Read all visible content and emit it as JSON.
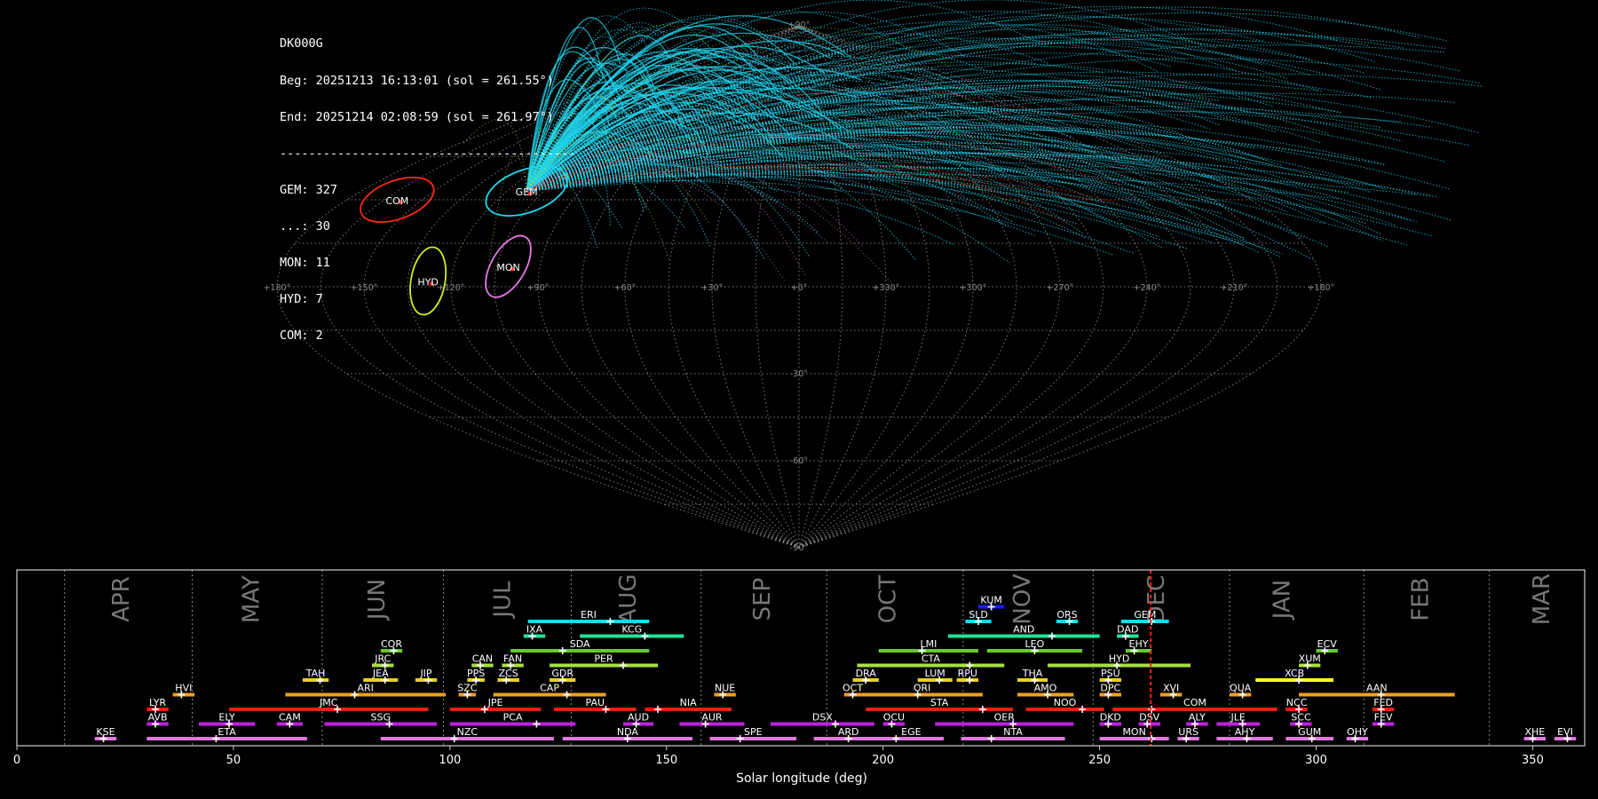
{
  "info": {
    "station": "DK000G",
    "begin": "Beg: 20251213 16:13:01 (sol = 261.55°)",
    "end": "End: 20251214 02:08:59 (sol = 261.97°)",
    "rule": "-----------------------------------------",
    "counts": [
      "GEM: 327",
      "...: 30",
      "MON: 11",
      "HYD: 7",
      "COM: 2"
    ]
  },
  "colors": {
    "background": "#000000",
    "grid": "#9a9a9a",
    "gem": "#1fd6f0",
    "sporadic": "#b8e020",
    "mon": "#e678e6",
    "hyd": "#c8f020",
    "com": "#ff2a10",
    "timeline_frame": "#cccccc",
    "solar_marker": "#ff2020"
  },
  "sky_map": {
    "projection": "sinusoidal",
    "center_ra": 0,
    "longitude_labels": [
      "+180°",
      "+150°",
      "+120°",
      "+90°",
      "+60°",
      "+30°",
      "+0°",
      "+330°",
      "+300°",
      "+270°",
      "+240°",
      "+210°",
      "+180°"
    ],
    "latitude_labels": [
      "+90°",
      "-30°",
      "-60°",
      "-90°"
    ],
    "radiants": [
      {
        "code": "GEM",
        "ra": 112,
        "dec": 33,
        "size": 10,
        "color": "#1fd6f0",
        "label": "GEM"
      },
      {
        "code": "COM",
        "ra": 160,
        "dec": 30,
        "size": 9,
        "color": "#ff2a10",
        "label": "COM"
      },
      {
        "code": "MON",
        "ra": 101,
        "dec": 7,
        "size": 8,
        "color": "#e678e6",
        "label": "MON"
      },
      {
        "code": "HYD",
        "ra": 128,
        "dec": 2,
        "size": 8,
        "color": "#c8f020",
        "label": "HYD"
      }
    ]
  },
  "chart_data": {
    "type": "timeline",
    "xlabel": "Solar longitude (deg)",
    "xlim": [
      0,
      362
    ],
    "xticks": [
      0,
      50,
      100,
      150,
      200,
      250,
      300,
      350
    ],
    "current_sol": 261.8,
    "months": [
      {
        "name": "APR",
        "pos": 24,
        "boundary": 11
      },
      {
        "name": "MAY",
        "pos": 54,
        "boundary": 40.5
      },
      {
        "name": "JUN",
        "pos": 83,
        "boundary": 70.5
      },
      {
        "name": "JUL",
        "pos": 112,
        "boundary": 98.5
      },
      {
        "name": "AUG",
        "pos": 141,
        "boundary": 128
      },
      {
        "name": "SEP",
        "pos": 172,
        "boundary": 158
      },
      {
        "name": "OCT",
        "pos": 201,
        "boundary": 187
      },
      {
        "name": "NOV",
        "pos": 232,
        "boundary": 218.5
      },
      {
        "name": "DEC",
        "pos": 263,
        "boundary": 248.5
      },
      {
        "name": "JAN",
        "pos": 292,
        "boundary": 280
      },
      {
        "name": "FEB",
        "pos": 324,
        "boundary": 311
      },
      {
        "name": "MAR",
        "pos": 352,
        "boundary": 340
      }
    ],
    "showers": [
      {
        "code": "KUM",
        "start": 222,
        "end": 228,
        "peak": 225,
        "row": 10,
        "color": "#1a1aff"
      },
      {
        "code": "ERI",
        "start": 118,
        "end": 146,
        "peak": 137,
        "row": 9,
        "color": "#1fd6f0"
      },
      {
        "code": "SLD",
        "start": 219,
        "end": 225,
        "peak": 222,
        "row": 9,
        "color": "#1fd6f0"
      },
      {
        "code": "ORS",
        "start": 240,
        "end": 245,
        "peak": 243,
        "row": 9,
        "color": "#1fd6f0"
      },
      {
        "code": "GEM",
        "start": 255,
        "end": 266,
        "peak": 262,
        "row": 9,
        "color": "#1fd6f0"
      },
      {
        "code": "IXA",
        "start": 117,
        "end": 122,
        "peak": 119,
        "row": 8,
        "color": "#22e29a"
      },
      {
        "code": "KCG",
        "start": 130,
        "end": 154,
        "peak": 145,
        "row": 8,
        "color": "#22e29a"
      },
      {
        "code": "AND",
        "start": 215,
        "end": 250,
        "peak": 239,
        "row": 8,
        "color": "#22e29a"
      },
      {
        "code": "DAD",
        "start": 254,
        "end": 259,
        "peak": 256,
        "row": 8,
        "color": "#22e29a"
      },
      {
        "code": "COR",
        "start": 84,
        "end": 89,
        "peak": 87,
        "row": 7,
        "color": "#66cc22"
      },
      {
        "code": "SDA",
        "start": 114,
        "end": 146,
        "peak": 126,
        "row": 7,
        "color": "#66cc22"
      },
      {
        "code": "LMI",
        "start": 199,
        "end": 222,
        "peak": 209,
        "row": 7,
        "color": "#66cc22"
      },
      {
        "code": "LEO",
        "start": 224,
        "end": 246,
        "peak": 235,
        "row": 7,
        "color": "#66cc22"
      },
      {
        "code": "EHY",
        "start": 256,
        "end": 262,
        "peak": 258,
        "row": 7,
        "color": "#66cc22"
      },
      {
        "code": "ECV",
        "start": 300,
        "end": 305,
        "peak": 302,
        "row": 7,
        "color": "#66cc22"
      },
      {
        "code": "JRC",
        "start": 82,
        "end": 87,
        "peak": 85,
        "row": 6,
        "color": "#a8e040"
      },
      {
        "code": "CAN",
        "start": 105,
        "end": 110,
        "peak": 107,
        "row": 6,
        "color": "#a8e040"
      },
      {
        "code": "FAN",
        "start": 112,
        "end": 117,
        "peak": 114,
        "row": 6,
        "color": "#a8e040"
      },
      {
        "code": "PER",
        "start": 123,
        "end": 148,
        "peak": 140,
        "row": 6,
        "color": "#a8e040"
      },
      {
        "code": "CTA",
        "start": 194,
        "end": 228,
        "peak": 220,
        "row": 6,
        "color": "#a8e040"
      },
      {
        "code": "HYD",
        "start": 238,
        "end": 271,
        "peak": 254,
        "row": 6,
        "color": "#a8e040"
      },
      {
        "code": "XUM",
        "start": 296,
        "end": 301,
        "peak": 298,
        "row": 6,
        "color": "#a8e040"
      },
      {
        "code": "TAH",
        "start": 66,
        "end": 72,
        "peak": 70,
        "row": 5,
        "color": "#e8d020"
      },
      {
        "code": "JEA",
        "start": 80,
        "end": 88,
        "peak": 85,
        "row": 5,
        "color": "#e8d020"
      },
      {
        "code": "JIP",
        "start": 92,
        "end": 97,
        "peak": 95,
        "row": 5,
        "color": "#e8d020"
      },
      {
        "code": "PPS",
        "start": 104,
        "end": 108,
        "peak": 106,
        "row": 5,
        "color": "#e8d020"
      },
      {
        "code": "ZCS",
        "start": 111,
        "end": 116,
        "peak": 113,
        "row": 5,
        "color": "#e8d020"
      },
      {
        "code": "GDR",
        "start": 123,
        "end": 129,
        "peak": 126,
        "row": 5,
        "color": "#e8d020"
      },
      {
        "code": "DRA",
        "start": 193,
        "end": 199,
        "peak": 196,
        "row": 5,
        "color": "#e8d020"
      },
      {
        "code": "LUM",
        "start": 208,
        "end": 216,
        "peak": 213,
        "row": 5,
        "color": "#e8d020"
      },
      {
        "code": "RPU",
        "start": 217,
        "end": 222,
        "peak": 220,
        "row": 5,
        "color": "#e8d020"
      },
      {
        "code": "THA",
        "start": 231,
        "end": 238,
        "peak": 235,
        "row": 5,
        "color": "#e8d020"
      },
      {
        "code": "PSU",
        "start": 250,
        "end": 255,
        "peak": 252,
        "row": 5,
        "color": "#e8d020"
      },
      {
        "code": "XCB",
        "start": 286,
        "end": 304,
        "peak": 296,
        "row": 5,
        "color": "#ffff20"
      },
      {
        "code": "HVI",
        "start": 36,
        "end": 41,
        "peak": 38,
        "row": 4,
        "color": "#f0a020"
      },
      {
        "code": "ARI",
        "start": 62,
        "end": 99,
        "peak": 78,
        "row": 4,
        "color": "#f0a020"
      },
      {
        "code": "SZC",
        "start": 102,
        "end": 106,
        "peak": 104,
        "row": 4,
        "color": "#f0a020"
      },
      {
        "code": "CAP",
        "start": 110,
        "end": 136,
        "peak": 127,
        "row": 4,
        "color": "#f0a020"
      },
      {
        "code": "NUE",
        "start": 161,
        "end": 166,
        "peak": 163,
        "row": 4,
        "color": "#f0a020"
      },
      {
        "code": "OCT",
        "start": 191,
        "end": 195,
        "peak": 193,
        "row": 4,
        "color": "#f0a020"
      },
      {
        "code": "ORI",
        "start": 195,
        "end": 223,
        "peak": 208,
        "row": 4,
        "color": "#f0a020"
      },
      {
        "code": "AMO",
        "start": 231,
        "end": 244,
        "peak": 238,
        "row": 4,
        "color": "#f0a020"
      },
      {
        "code": "DPC",
        "start": 250,
        "end": 255,
        "peak": 252,
        "row": 4,
        "color": "#f0a020"
      },
      {
        "code": "XVI",
        "start": 264,
        "end": 269,
        "peak": 267,
        "row": 4,
        "color": "#f0a020"
      },
      {
        "code": "QUA",
        "start": 280,
        "end": 285,
        "peak": 283,
        "row": 4,
        "color": "#f0a020"
      },
      {
        "code": "AAN",
        "start": 296,
        "end": 332,
        "peak": 315,
        "row": 4,
        "color": "#f0a020"
      },
      {
        "code": "LYR",
        "start": 30,
        "end": 35,
        "peak": 32,
        "row": 3,
        "color": "#e82010"
      },
      {
        "code": "JMC",
        "start": 49,
        "end": 95,
        "peak": 74,
        "row": 3,
        "color": "#e82010"
      },
      {
        "code": "JPE",
        "start": 100,
        "end": 121,
        "peak": 108,
        "row": 3,
        "color": "#e82010"
      },
      {
        "code": "PAU",
        "start": 124,
        "end": 143,
        "peak": 136,
        "row": 3,
        "color": "#e82010"
      },
      {
        "code": "NIA",
        "start": 145,
        "end": 165,
        "peak": 148,
        "row": 3,
        "color": "#e82010"
      },
      {
        "code": "STA",
        "start": 196,
        "end": 230,
        "peak": 223,
        "row": 3,
        "color": "#e82010"
      },
      {
        "code": "NOO",
        "start": 233,
        "end": 251,
        "peak": 246,
        "row": 3,
        "color": "#e82010"
      },
      {
        "code": "COM",
        "start": 253,
        "end": 291,
        "peak": 262,
        "row": 3,
        "color": "#e82010"
      },
      {
        "code": "NCC",
        "start": 293,
        "end": 298,
        "peak": 296,
        "row": 3,
        "color": "#e82010"
      },
      {
        "code": "FED",
        "start": 313,
        "end": 318,
        "peak": 315,
        "row": 3,
        "color": "#e82010"
      },
      {
        "code": "AVB",
        "start": 30,
        "end": 35,
        "peak": 32,
        "row": 2,
        "color": "#c020e0"
      },
      {
        "code": "ELY",
        "start": 42,
        "end": 55,
        "peak": 49,
        "row": 2,
        "color": "#c020e0"
      },
      {
        "code": "CAM",
        "start": 60,
        "end": 66,
        "peak": 63,
        "row": 2,
        "color": "#c020e0"
      },
      {
        "code": "SSG",
        "start": 71,
        "end": 97,
        "peak": 86,
        "row": 2,
        "color": "#c020e0"
      },
      {
        "code": "PCA",
        "start": 100,
        "end": 129,
        "peak": 120,
        "row": 2,
        "color": "#c020e0"
      },
      {
        "code": "AUD",
        "start": 140,
        "end": 147,
        "peak": 143,
        "row": 2,
        "color": "#c020e0"
      },
      {
        "code": "AUR",
        "start": 153,
        "end": 168,
        "peak": 159,
        "row": 2,
        "color": "#c020e0"
      },
      {
        "code": "DSX",
        "start": 174,
        "end": 198,
        "peak": 189,
        "row": 2,
        "color": "#c020e0"
      },
      {
        "code": "OCU",
        "start": 200,
        "end": 205,
        "peak": 202,
        "row": 2,
        "color": "#c020e0"
      },
      {
        "code": "OER",
        "start": 212,
        "end": 244,
        "peak": 230,
        "row": 2,
        "color": "#c020e0"
      },
      {
        "code": "DKD",
        "start": 250,
        "end": 255,
        "peak": 252,
        "row": 2,
        "color": "#c020e0"
      },
      {
        "code": "DSV",
        "start": 259,
        "end": 264,
        "peak": 261,
        "row": 2,
        "color": "#c020e0"
      },
      {
        "code": "ALY",
        "start": 270,
        "end": 275,
        "peak": 272,
        "row": 2,
        "color": "#c020e0"
      },
      {
        "code": "JLE",
        "start": 277,
        "end": 287,
        "peak": 283,
        "row": 2,
        "color": "#c020e0"
      },
      {
        "code": "SCC",
        "start": 294,
        "end": 299,
        "peak": 296,
        "row": 2,
        "color": "#c020e0"
      },
      {
        "code": "FEV",
        "start": 313,
        "end": 318,
        "peak": 315,
        "row": 2,
        "color": "#c020e0"
      },
      {
        "code": "KSE",
        "start": 18,
        "end": 23,
        "peak": 20,
        "row": 1,
        "color": "#e078e0"
      },
      {
        "code": "ETA",
        "start": 30,
        "end": 67,
        "peak": 46,
        "row": 1,
        "color": "#e078e0"
      },
      {
        "code": "NZC",
        "start": 84,
        "end": 124,
        "peak": 101,
        "row": 1,
        "color": "#e078e0"
      },
      {
        "code": "NDA",
        "start": 126,
        "end": 156,
        "peak": 141,
        "row": 1,
        "color": "#e078e0"
      },
      {
        "code": "SPE",
        "start": 160,
        "end": 180,
        "peak": 167,
        "row": 1,
        "color": "#e078e0"
      },
      {
        "code": "ARD",
        "start": 184,
        "end": 200,
        "peak": 192,
        "row": 1,
        "color": "#e078e0"
      },
      {
        "code": "EGE",
        "start": 199,
        "end": 214,
        "peak": 203,
        "row": 1,
        "color": "#e078e0"
      },
      {
        "code": "NTA",
        "start": 218,
        "end": 242,
        "peak": 225,
        "row": 1,
        "color": "#e078e0"
      },
      {
        "code": "MON",
        "start": 250,
        "end": 266,
        "peak": 262,
        "row": 1,
        "color": "#e078e0"
      },
      {
        "code": "URS",
        "start": 268,
        "end": 273,
        "peak": 270,
        "row": 1,
        "color": "#e078e0"
      },
      {
        "code": "AHY",
        "start": 277,
        "end": 290,
        "peak": 284,
        "row": 1,
        "color": "#e078e0"
      },
      {
        "code": "GUM",
        "start": 293,
        "end": 304,
        "peak": 299,
        "row": 1,
        "color": "#e078e0"
      },
      {
        "code": "OHY",
        "start": 307,
        "end": 312,
        "peak": 309,
        "row": 1,
        "color": "#e078e0"
      },
      {
        "code": "XHE",
        "start": 348,
        "end": 353,
        "peak": 350,
        "row": 1,
        "color": "#e078e0"
      },
      {
        "code": "EVI",
        "start": 355,
        "end": 360,
        "peak": 358,
        "row": 1,
        "color": "#e078e0"
      }
    ]
  }
}
